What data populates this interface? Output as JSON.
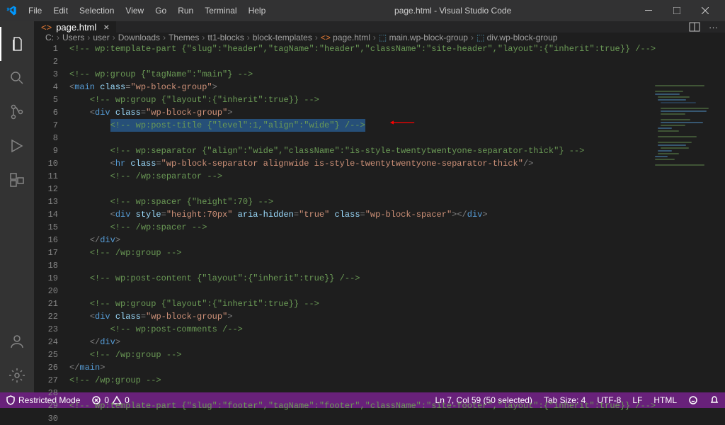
{
  "window": {
    "title": "page.html - Visual Studio Code"
  },
  "menu": [
    "File",
    "Edit",
    "Selection",
    "View",
    "Go",
    "Run",
    "Terminal",
    "Help"
  ],
  "tab": {
    "name": "page.html"
  },
  "breadcrumbs": [
    "C:",
    "Users",
    "user",
    "Downloads",
    "Themes",
    "tt1-blocks",
    "block-templates"
  ],
  "breadcrumbs_file": "page.html",
  "breadcrumbs_symbols": [
    "main.wp-block-group",
    "div.wp-block-group"
  ],
  "code": {
    "lines": [
      {
        "n": 1,
        "indent": 0,
        "type": "comment",
        "text": "<!-- wp:template-part {\"slug\":\"header\",\"tagName\":\"header\",\"className\":\"site-header\",\"layout\":{\"inherit\":true}} /-->"
      },
      {
        "n": 2,
        "indent": 0,
        "type": "blank",
        "text": ""
      },
      {
        "n": 3,
        "indent": 0,
        "type": "comment",
        "text": "<!-- wp:group {\"tagName\":\"main\"} -->"
      },
      {
        "n": 4,
        "indent": 0,
        "type": "tag-open",
        "tag": "main",
        "attrs": [
          {
            "name": "class",
            "value": "wp-block-group"
          }
        ]
      },
      {
        "n": 5,
        "indent": 1,
        "type": "comment",
        "text": "<!-- wp:group {\"layout\":{\"inherit\":true}} -->"
      },
      {
        "n": 6,
        "indent": 1,
        "type": "tag-open",
        "tag": "div",
        "attrs": [
          {
            "name": "class",
            "value": "wp-block-group"
          }
        ]
      },
      {
        "n": 7,
        "indent": 2,
        "type": "selected-comment",
        "text": "<!-- wp:post-title {\"level\":1,\"align\":\"wide\"} /-->"
      },
      {
        "n": 8,
        "indent": 0,
        "type": "blank",
        "text": ""
      },
      {
        "n": 9,
        "indent": 2,
        "type": "comment",
        "text": "<!-- wp:separator {\"align\":\"wide\",\"className\":\"is-style-twentytwentyone-separator-thick\"} -->"
      },
      {
        "n": 10,
        "indent": 2,
        "type": "tag-self",
        "tag": "hr",
        "attrs": [
          {
            "name": "class",
            "value": "wp-block-separator alignwide is-style-twentytwentyone-separator-thick"
          }
        ]
      },
      {
        "n": 11,
        "indent": 2,
        "type": "comment",
        "text": "<!-- /wp:separator -->"
      },
      {
        "n": 12,
        "indent": 0,
        "type": "blank",
        "text": ""
      },
      {
        "n": 13,
        "indent": 2,
        "type": "comment",
        "text": "<!-- wp:spacer {\"height\":70} -->"
      },
      {
        "n": 14,
        "indent": 2,
        "type": "tag-pair",
        "tag": "div",
        "attrs": [
          {
            "name": "style",
            "value": "height:70px"
          },
          {
            "name": "aria-hidden",
            "value": "true"
          },
          {
            "name": "class",
            "value": "wp-block-spacer"
          }
        ]
      },
      {
        "n": 15,
        "indent": 2,
        "type": "comment",
        "text": "<!-- /wp:spacer -->"
      },
      {
        "n": 16,
        "indent": 1,
        "type": "tag-close",
        "tag": "div"
      },
      {
        "n": 17,
        "indent": 1,
        "type": "comment",
        "text": "<!-- /wp:group -->"
      },
      {
        "n": 18,
        "indent": 0,
        "type": "blank",
        "text": ""
      },
      {
        "n": 19,
        "indent": 1,
        "type": "comment",
        "text": "<!-- wp:post-content {\"layout\":{\"inherit\":true}} /-->"
      },
      {
        "n": 20,
        "indent": 0,
        "type": "blank",
        "text": ""
      },
      {
        "n": 21,
        "indent": 1,
        "type": "comment",
        "text": "<!-- wp:group {\"layout\":{\"inherit\":true}} -->"
      },
      {
        "n": 22,
        "indent": 1,
        "type": "tag-open",
        "tag": "div",
        "attrs": [
          {
            "name": "class",
            "value": "wp-block-group"
          }
        ]
      },
      {
        "n": 23,
        "indent": 2,
        "type": "comment",
        "text": "<!-- wp:post-comments /-->"
      },
      {
        "n": 24,
        "indent": 1,
        "type": "tag-close",
        "tag": "div"
      },
      {
        "n": 25,
        "indent": 1,
        "type": "comment",
        "text": "<!-- /wp:group -->"
      },
      {
        "n": 26,
        "indent": 0,
        "type": "tag-close",
        "tag": "main"
      },
      {
        "n": 27,
        "indent": 0,
        "type": "comment",
        "text": "<!-- /wp:group -->"
      },
      {
        "n": 28,
        "indent": 0,
        "type": "blank",
        "text": ""
      },
      {
        "n": 29,
        "indent": 0,
        "type": "comment",
        "text": "<!-- wp:template-part {\"slug\":\"footer\",\"tagName\":\"footer\",\"className\":\"site-footer\",\"layout\":{\"inherit\":true}} /-->"
      },
      {
        "n": 30,
        "indent": 0,
        "type": "blank",
        "text": ""
      }
    ]
  },
  "status": {
    "restricted": "Restricted Mode",
    "problems": "0",
    "warnings": "0",
    "cursor": "Ln 7, Col 59 (50 selected)",
    "tabsize": "Tab Size: 4",
    "encoding": "UTF-8",
    "eol": "LF",
    "lang": "HTML"
  }
}
